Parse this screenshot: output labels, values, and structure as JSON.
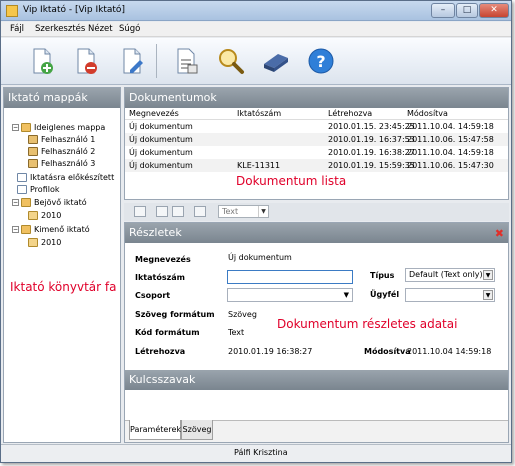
{
  "window": {
    "title": "Vip Iktató - [Vip Iktató]"
  },
  "menu": [
    "Fájl",
    "Szerkesztés",
    "Nézet",
    "Súgó"
  ],
  "toolbar": {
    "buttons": [
      "new-document-icon",
      "delete-document-icon",
      "edit-document-icon",
      "print-document-icon",
      "search-icon",
      "scanner-icon",
      "help-icon"
    ]
  },
  "tree": {
    "title": "Iktató mappák",
    "items": [
      "Ideiglenes mappa",
      "Felhasználó 1",
      "Felhasználó 2",
      "Felhasználó 3",
      "Iktatásra előkészített",
      "Profilok",
      "Bejövő iktató",
      "2010",
      "Kimenő iktató",
      "2010"
    ],
    "overlay": "Iktató könyvtár fa"
  },
  "documents": {
    "title": "Dokumentumok",
    "columns": [
      "Megnevezés",
      "Iktatószám",
      "Létrehozva",
      "Módosítva"
    ],
    "rows": [
      [
        "Új dokumentum",
        "",
        "2010.01.15. 23:45:25",
        "2011.10.04. 14:59:18"
      ],
      [
        "Új dokumentum",
        "",
        "2010.01.19. 16:37:53",
        "2011.10.06. 15:47:58"
      ],
      [
        "Új dokumentum",
        "",
        "2010.01.19. 16:38:27",
        "2011.10.04. 14:59:18"
      ],
      [
        "Új dokumentum",
        "KLE-11311",
        "2010.01.19. 15:59:35",
        "2011.10.06. 15:47:30"
      ]
    ],
    "overlay": "Dokumentum lista"
  },
  "filter": {
    "type_value": "Text"
  },
  "details": {
    "title": "Részletek",
    "labels": {
      "name": "Megnevezés",
      "number": "Iktatószám",
      "group": "Csoport",
      "text_format": "Szöveg formátum",
      "code_format": "Kód formátum",
      "created": "Létrehozva",
      "type": "Típus",
      "client": "Ügyfél",
      "modified": "Módosítva"
    },
    "values": {
      "name": "Új dokumentum",
      "number": "",
      "group": "",
      "text_format": "Szöveg",
      "code_format": "Text",
      "created": "2010.01.19 16:38:27",
      "type": "Default (Text only)",
      "client": "",
      "modified": "2011.10.04 14:59:18"
    },
    "overlay": "Dokumentum részletes adatai",
    "keywords_title": "Kulcsszavak",
    "tabs": [
      "Paraméterek",
      "Szöveg"
    ]
  },
  "status": {
    "user": "Pálfi Krisztina"
  }
}
